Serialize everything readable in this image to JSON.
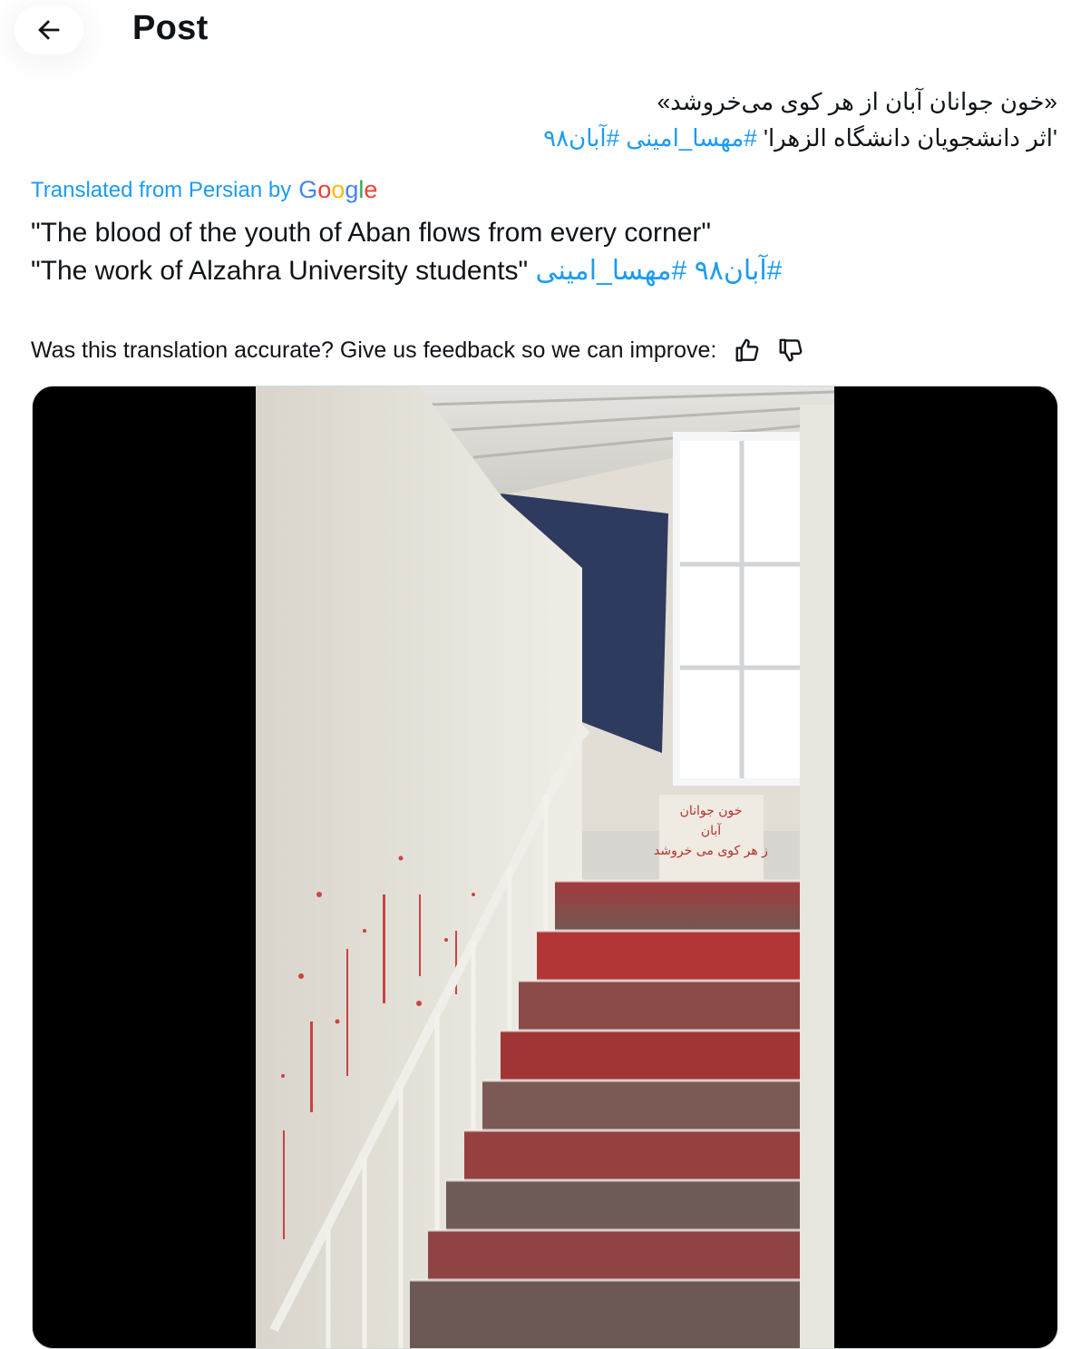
{
  "header": {
    "title": "Post"
  },
  "icons": {
    "back": "arrow-left-icon",
    "thumbs_up": "thumbs-up-icon",
    "thumbs_down": "thumbs-down-icon"
  },
  "original": {
    "line1": "«خون جوانان آبان از هر کوی می‌خروشد»",
    "line2_text": "'اثر دانشجویان دانشگاه الزهرا'",
    "hashtag_mahsa": "#مهسا_امینی",
    "hashtag_aban": "#آبان۹۸"
  },
  "translation": {
    "attribution_text": "Translated from Persian by",
    "provider": "Google",
    "line1": "\"The blood of the youth of Aban flows from every corner\"",
    "line2_text": "\"The work of Alzahra University students\"",
    "hashtags": "#آبان۹۸ #مهسا_امینی"
  },
  "feedback": {
    "prompt": "Was this translation accurate? Give us feedback so we can improve:"
  },
  "photo": {
    "wall_writing": [
      "خون جوانان",
      "آبان",
      "ز هر کوی می خروشد"
    ]
  },
  "colors": {
    "link": "#1d9bf0",
    "paint": "#c42a2a",
    "accent_text": "#0f1419"
  }
}
